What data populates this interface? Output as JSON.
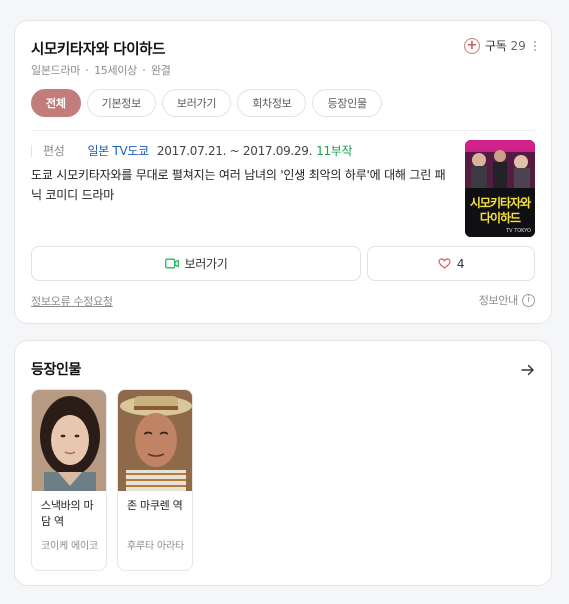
{
  "show": {
    "title": "시모키타자와 다이하드",
    "genre": "일본드라마",
    "rating": "15세이상",
    "status": "완결"
  },
  "subscribe": {
    "label": "구독",
    "count": "29"
  },
  "tabs": [
    {
      "label": "전체",
      "active": true
    },
    {
      "label": "기본정보"
    },
    {
      "label": "보러가기"
    },
    {
      "label": "회차정보"
    },
    {
      "label": "등장인물"
    }
  ],
  "airing": {
    "label": "편성",
    "network": "일본 TV도쿄",
    "dates": "2017.07.21. ~ 2017.09.29.",
    "episodes": "11부작"
  },
  "description": "도쿄 시모키타자와를 무대로 펼쳐지는 여러 남녀의 '인생 최악의 하루'에 대해 그린 패닉 코미디 드라마",
  "poster": {
    "text": "시모키타자와 다이하드",
    "small": "TV TOKYO"
  },
  "actions": {
    "watch_label": "보러가기",
    "like_count": "4"
  },
  "footer": {
    "report_label": "정보오류 수정요청",
    "info_label": "정보안내"
  },
  "cast_section": {
    "title": "등장인물",
    "items": [
      {
        "role": "스낵바의 마담 역",
        "actor": "코이케 에이코"
      },
      {
        "role": "존 마쿠렌 역",
        "actor": "후루타 아라타"
      }
    ]
  },
  "colors": {
    "accent": "#c27c7c",
    "link": "#1e5fb8",
    "green": "#17a34a"
  }
}
